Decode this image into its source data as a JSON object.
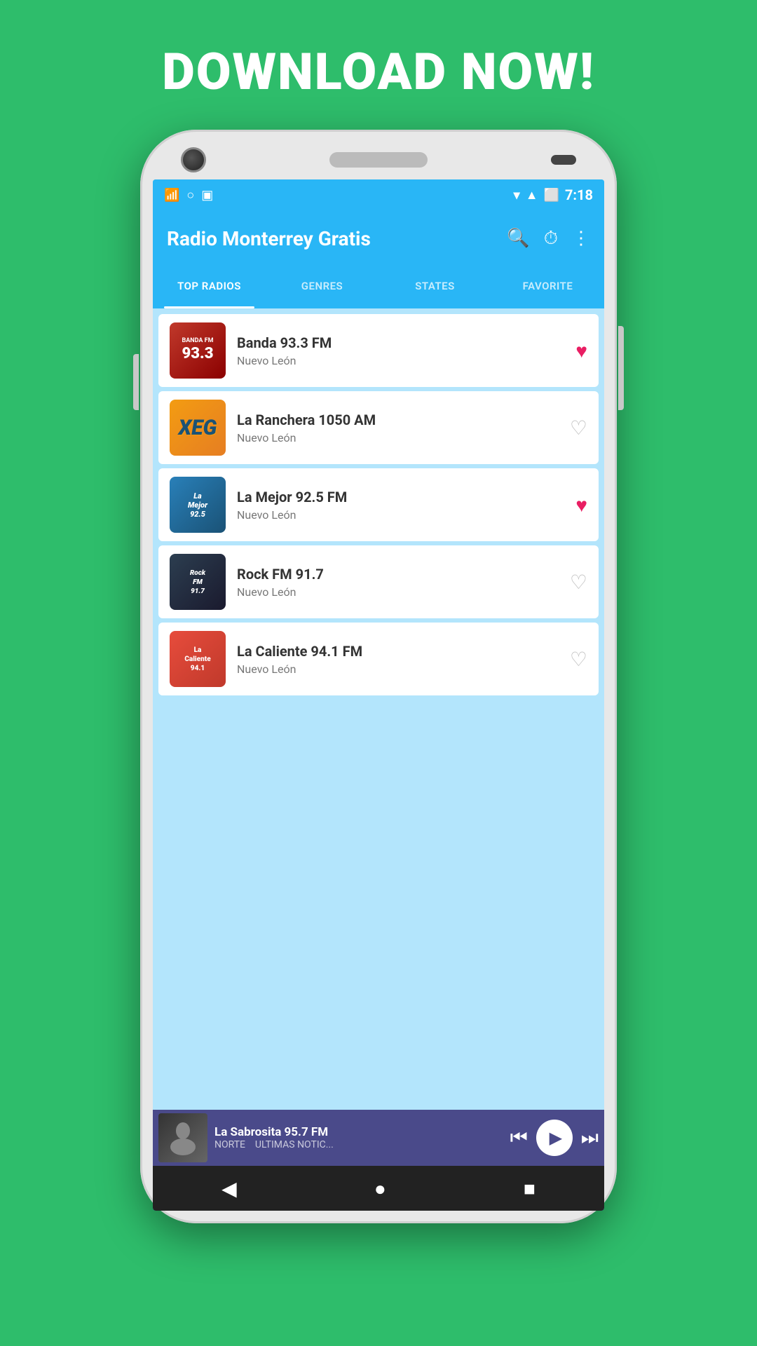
{
  "page": {
    "headline": "DOWNLOAD NOW!",
    "background_color": "#2ebd6b"
  },
  "app": {
    "title": "Radio Monterrey Gratis",
    "time": "7:18"
  },
  "tabs": [
    {
      "id": "top-radios",
      "label": "TOP RADIOS",
      "active": true
    },
    {
      "id": "genres",
      "label": "GENRES",
      "active": false
    },
    {
      "id": "states",
      "label": "STATES",
      "active": false
    },
    {
      "id": "favorite",
      "label": "FAVORITE",
      "active": false
    }
  ],
  "radios": [
    {
      "id": 1,
      "name": "Banda 93.3 FM",
      "location": "Nuevo León",
      "logo_label": "BANDA FM\n93.3",
      "logo_type": "banda",
      "favorited": true
    },
    {
      "id": 2,
      "name": "La Ranchera 1050 AM",
      "location": "Nuevo León",
      "logo_label": "XEG",
      "logo_type": "xeg",
      "favorited": false
    },
    {
      "id": 3,
      "name": "La Mejor 92.5 FM",
      "location": "Nuevo León",
      "logo_label": "La Mejor 92.5",
      "logo_type": "mejor",
      "favorited": true
    },
    {
      "id": 4,
      "name": "Rock FM 91.7",
      "location": "Nuevo León",
      "logo_label": "Rock FM 91.7",
      "logo_type": "rock",
      "favorited": false
    },
    {
      "id": 5,
      "name": "La Caliente 94.1 FM",
      "location": "Nuevo León",
      "logo_label": "Caliente 94.1",
      "logo_type": "caliente",
      "favorited": false
    }
  ],
  "now_playing": {
    "name": "La Sabrosita 95.7 FM",
    "subtitle1": "NORTE",
    "subtitle2": "ULTIMAS NOTIC..."
  },
  "icons": {
    "search": "🔍",
    "timer": "⏱",
    "more": "⋮",
    "prev": "⏮",
    "play": "▶",
    "next": "⏭",
    "back": "◀",
    "home": "●",
    "square": "■",
    "wifi": "▾",
    "battery": "🔋",
    "signal": "▲",
    "heart_filled": "♥",
    "heart_empty": "♡"
  }
}
